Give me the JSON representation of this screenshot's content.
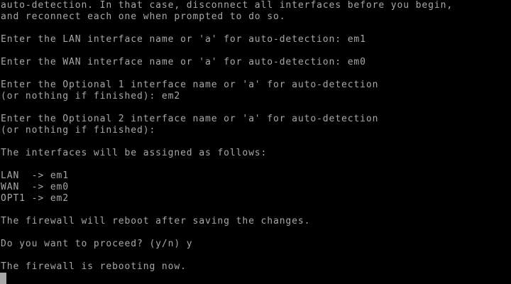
{
  "console": {
    "fg_color": "#a8a8a8",
    "bg_color": "#000000",
    "lines": [
      "auto-detection. In that case, disconnect all interfaces before you begin,",
      "and reconnect each one when prompted to do so.",
      "",
      "Enter the LAN interface name or 'a' for auto-detection: em1",
      "",
      "Enter the WAN interface name or 'a' for auto-detection: em0",
      "",
      "Enter the Optional 1 interface name or 'a' for auto-detection",
      "(or nothing if finished): em2",
      "",
      "Enter the Optional 2 interface name or 'a' for auto-detection",
      "(or nothing if finished):",
      "",
      "The interfaces will be assigned as follows:",
      "",
      "LAN  -> em1",
      "WAN  -> em0",
      "OPT1 -> em2",
      "",
      "The firewall will reboot after saving the changes.",
      "",
      "Do you want to proceed? (y/n) y",
      "",
      "The firewall is rebooting now."
    ]
  }
}
